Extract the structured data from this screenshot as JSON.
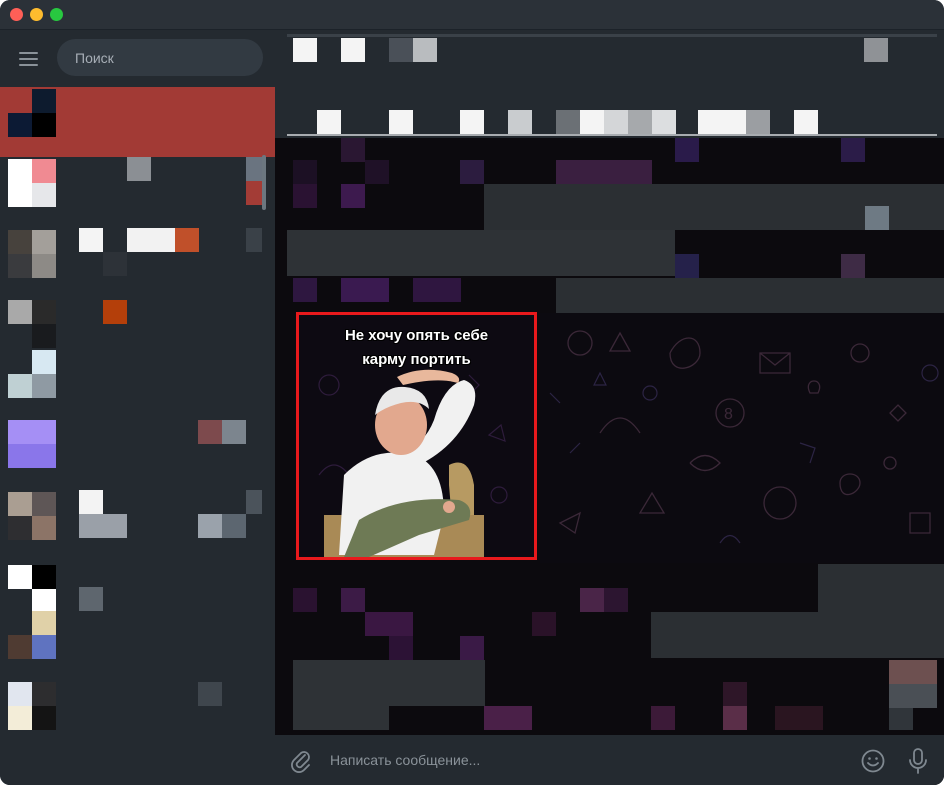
{
  "sidebar": {
    "search_placeholder": "Поиск"
  },
  "sticker": {
    "caption_line1": "Не хочу опять себе",
    "caption_line2": "карму портить"
  },
  "composer": {
    "placeholder": "Написать сообщение..."
  },
  "colors": {
    "active_chat": "#a23a35",
    "sticker_border": "#e8191c",
    "sidebar_bg": "#242a30"
  },
  "icons": [
    "menu-icon",
    "attach-icon",
    "emoji-icon",
    "microphone-icon"
  ]
}
